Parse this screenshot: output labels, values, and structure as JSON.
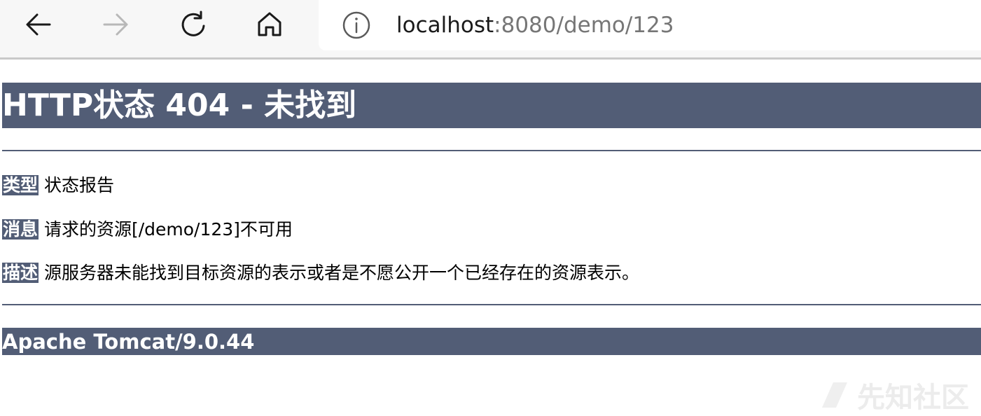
{
  "browser": {
    "url_host": "localhost",
    "url_path": ":8080/demo/123",
    "icons": {
      "back": "back-arrow-icon",
      "forward": "forward-arrow-icon",
      "reload": "reload-icon",
      "home": "home-icon",
      "info": "info-icon"
    }
  },
  "page": {
    "title": "HTTP状态 404 - 未找到",
    "type_label": "类型",
    "type_value": "状态报告",
    "message_label": "消息",
    "message_value": "请求的资源[/demo/123]不可用",
    "description_label": "描述",
    "description_value": "源服务器未能找到目标资源的表示或者是不愿公开一个已经存在的资源表示。",
    "footer": "Apache Tomcat/9.0.44"
  },
  "watermark": {
    "text": "先知社区"
  },
  "colors": {
    "header_bg": "#525d76",
    "header_text": "#ffffff",
    "toolbar_bg": "#f7f7f7",
    "url_path": "#767676"
  }
}
